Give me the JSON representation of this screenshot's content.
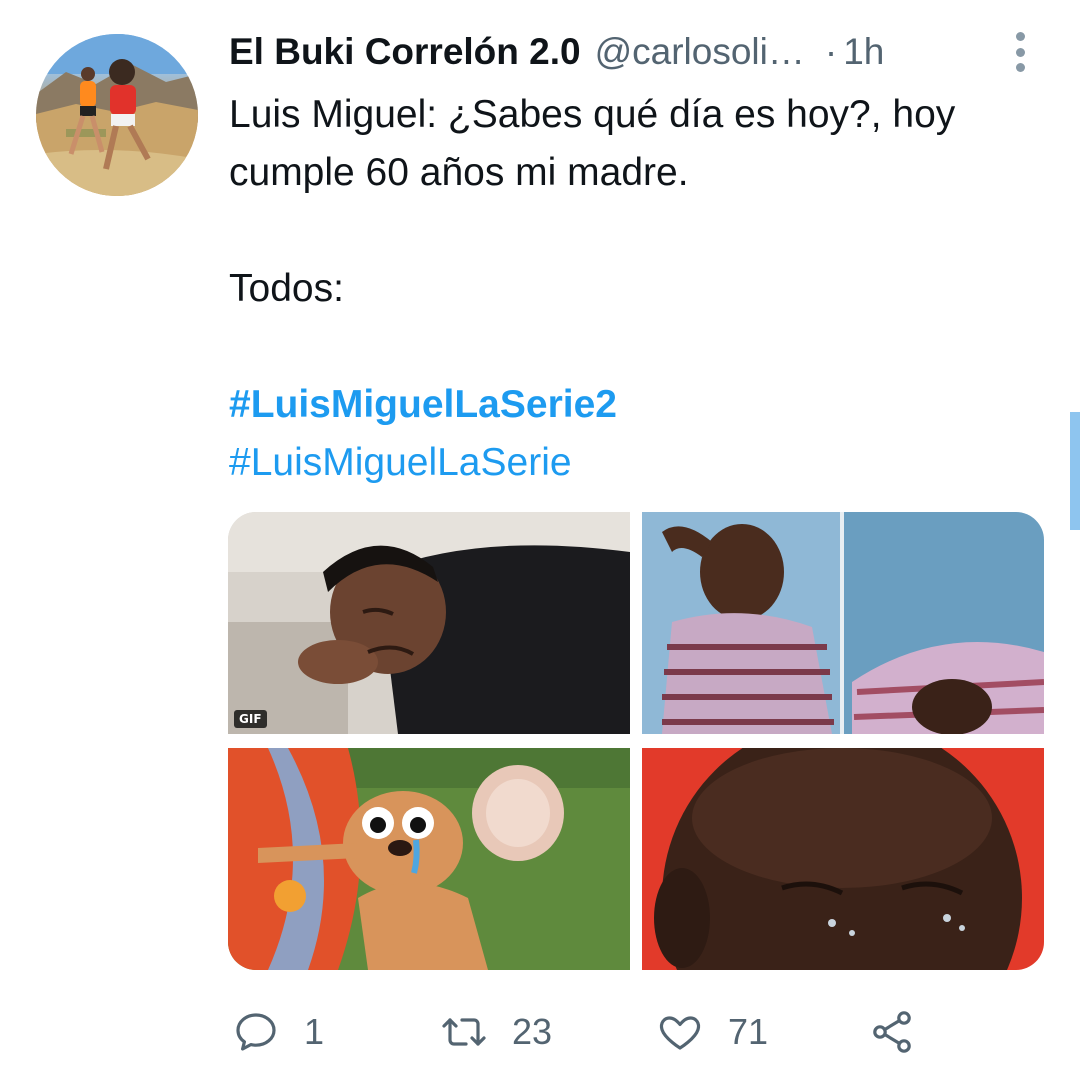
{
  "tweet": {
    "display_name": "El Buki Correlón 2.0",
    "handle": "@carlosoli…",
    "separator": "·",
    "time": "1h",
    "text_lines": [
      "Luis Miguel: ¿Sabes qué día es hoy?, hoy",
      "cumple 60 años mi madre.",
      "",
      "Todos:",
      ""
    ],
    "hashtags": [
      "#LuisMiguelLaSerie2",
      "#LuisMiguelLaSerie"
    ]
  },
  "media": {
    "gif_badge": "GIF",
    "items": [
      {
        "name": "crying-man-on-couch"
      },
      {
        "name": "crying-kid"
      },
      {
        "name": "crying-jerry-mouse"
      },
      {
        "name": "crying-jordan"
      }
    ]
  },
  "actions": {
    "reply_count": "1",
    "retweet_count": "23",
    "like_count": "71"
  },
  "icons": {
    "reply": "reply-icon",
    "retweet": "retweet-icon",
    "like": "heart-icon",
    "share": "share-icon",
    "more": "more-vertical-icon"
  },
  "colors": {
    "text": "#0f1419",
    "secondary": "#536471",
    "link": "#1d9bf0"
  }
}
